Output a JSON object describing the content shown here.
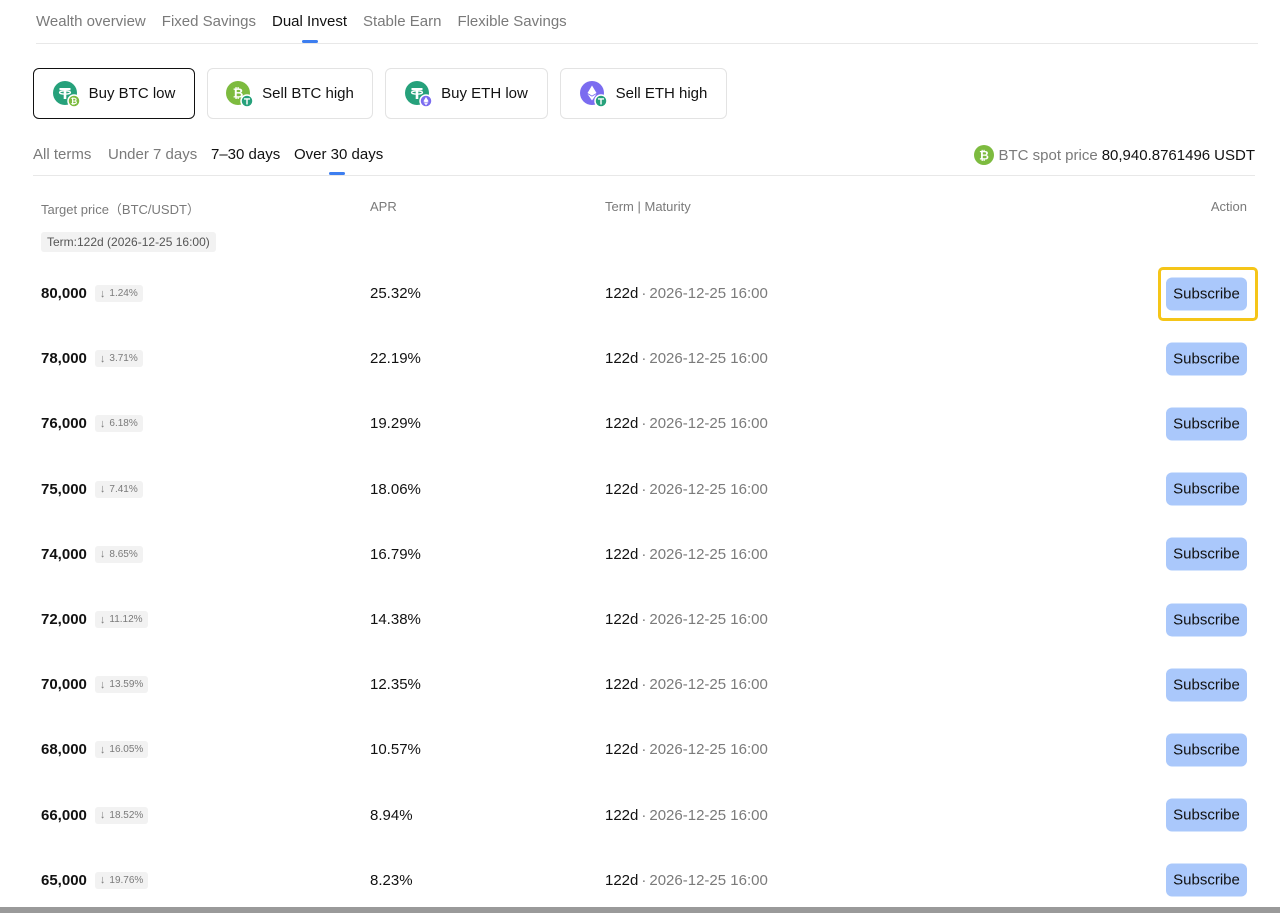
{
  "top_tabs": [
    {
      "label": "Wealth overview"
    },
    {
      "label": "Fixed Savings"
    },
    {
      "label": "Dual Invest"
    },
    {
      "label": "Stable Earn"
    },
    {
      "label": "Flexible Savings"
    }
  ],
  "products": [
    {
      "label": "Buy BTC low",
      "icon": "usdt-btc-icon"
    },
    {
      "label": "Sell BTC high",
      "icon": "btc-usdt-icon"
    },
    {
      "label": "Buy ETH low",
      "icon": "usdt-eth-icon"
    },
    {
      "label": "Sell ETH high",
      "icon": "eth-usdt-icon"
    }
  ],
  "terms": [
    {
      "label": "All terms"
    },
    {
      "label": "Under 7 days"
    },
    {
      "label": "7–30 days"
    },
    {
      "label": "Over 30 days"
    }
  ],
  "spot": {
    "icon": "btc-icon",
    "label": "BTC spot price",
    "value": "80,940.8761496",
    "unit": "USDT"
  },
  "table": {
    "headers": {
      "target": "Target price（BTC/USDT）",
      "apr": "APR",
      "term": "Term | Maturity",
      "action": "Action"
    },
    "term_badge": "Term:122d (2026-12-25 16:00)",
    "subscribe_label": "Subscribe",
    "rows": [
      {
        "price": "80,000",
        "delta": "1.24%",
        "apr": "25.32%",
        "days": "122d",
        "date": "2026-12-25 16:00"
      },
      {
        "price": "78,000",
        "delta": "3.71%",
        "apr": "22.19%",
        "days": "122d",
        "date": "2026-12-25 16:00"
      },
      {
        "price": "76,000",
        "delta": "6.18%",
        "apr": "19.29%",
        "days": "122d",
        "date": "2026-12-25 16:00"
      },
      {
        "price": "75,000",
        "delta": "7.41%",
        "apr": "18.06%",
        "days": "122d",
        "date": "2026-12-25 16:00"
      },
      {
        "price": "74,000",
        "delta": "8.65%",
        "apr": "16.79%",
        "days": "122d",
        "date": "2026-12-25 16:00"
      },
      {
        "price": "72,000",
        "delta": "11.12%",
        "apr": "14.38%",
        "days": "122d",
        "date": "2026-12-25 16:00"
      },
      {
        "price": "70,000",
        "delta": "13.59%",
        "apr": "12.35%",
        "days": "122d",
        "date": "2026-12-25 16:00"
      },
      {
        "price": "68,000",
        "delta": "16.05%",
        "apr": "10.57%",
        "days": "122d",
        "date": "2026-12-25 16:00"
      },
      {
        "price": "66,000",
        "delta": "18.52%",
        "apr": "8.94%",
        "days": "122d",
        "date": "2026-12-25 16:00"
      },
      {
        "price": "65,000",
        "delta": "19.76%",
        "apr": "8.23%",
        "days": "122d",
        "date": "2026-12-25 16:00"
      }
    ]
  },
  "colors": {
    "accent": "#3d7ef0",
    "subscribe_bg": "#aac8fb",
    "highlight": "#f5c518",
    "usdt": "#26a17b",
    "btc": "#7dbb3f",
    "eth": "#7b6cf0"
  }
}
